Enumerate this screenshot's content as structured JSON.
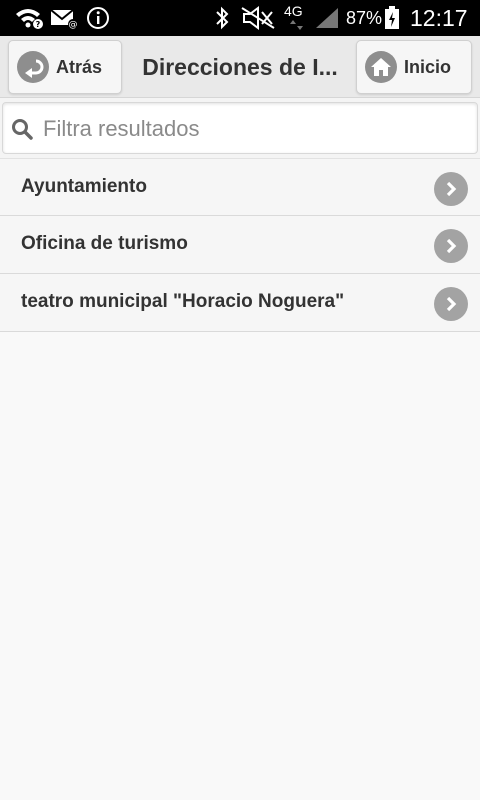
{
  "status_bar": {
    "battery_percent": "87%",
    "network_type": "4G",
    "time": "12:17",
    "icons": [
      "wifi-icon",
      "mail-icon",
      "info-icon",
      "bluetooth-icon",
      "mute-icon",
      "signal-icon",
      "battery-icon"
    ]
  },
  "header": {
    "back_label": "Atrás",
    "title": "Direcciones de I...",
    "home_label": "Inicio"
  },
  "search": {
    "placeholder": "Filtra resultados",
    "value": ""
  },
  "list": {
    "items": [
      {
        "label": "Ayuntamiento"
      },
      {
        "label": "Oficina de turismo"
      },
      {
        "label": "teatro municipal \"Horacio Noguera\""
      }
    ]
  },
  "colors": {
    "status_bar_bg": "#000000",
    "header_bg": "#e9e9e9",
    "page_bg": "#f9f9f9",
    "icon_circle": "#8e8e8e"
  }
}
